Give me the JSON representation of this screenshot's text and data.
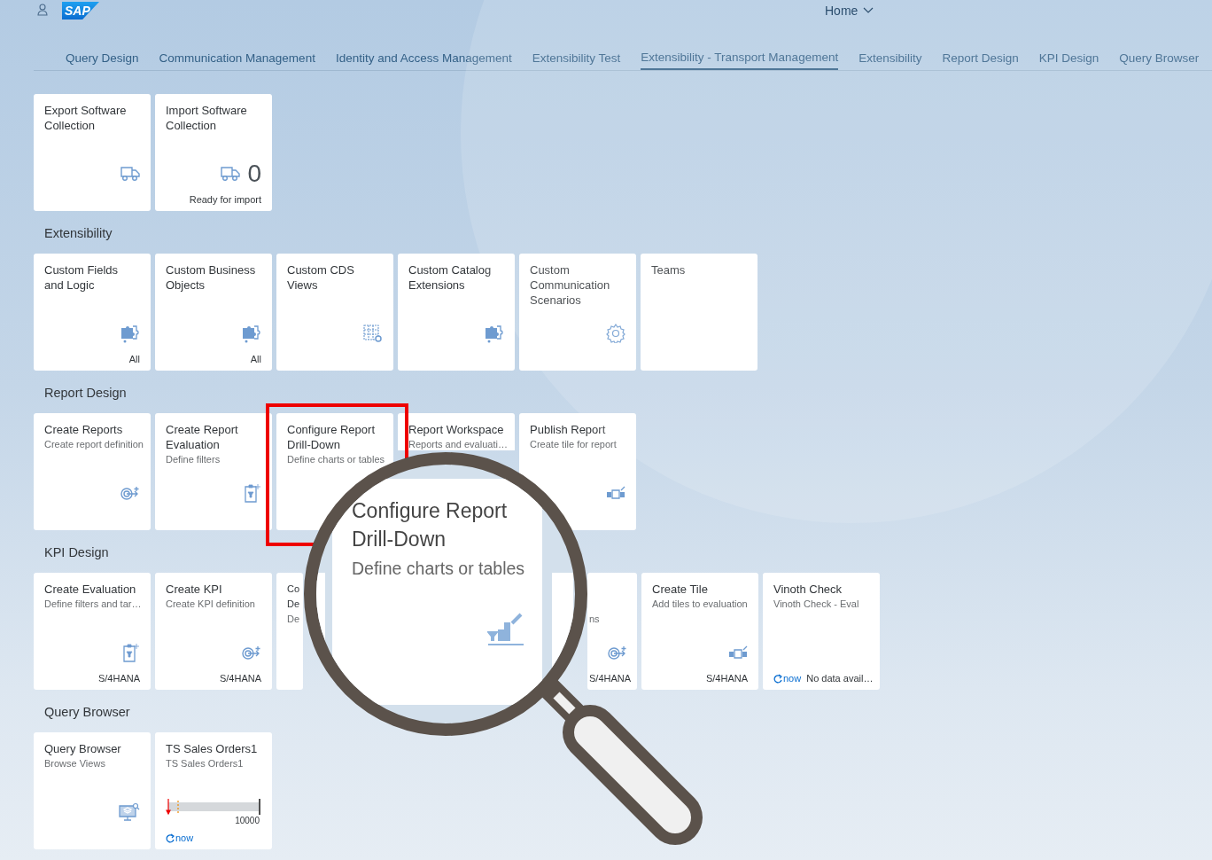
{
  "header": {
    "logo": "SAP",
    "title": "Home"
  },
  "tabs": [
    {
      "label": "Query Design",
      "selected": false
    },
    {
      "label": "Communication Management",
      "selected": false
    },
    {
      "label": "Identity and Access Management",
      "selected": false
    },
    {
      "label": "Extensibility Test",
      "selected": false
    },
    {
      "label": "Extensibility - Transport Management",
      "selected": true
    },
    {
      "label": "Extensibility",
      "selected": false
    },
    {
      "label": "Report Design",
      "selected": false
    },
    {
      "label": "KPI Design",
      "selected": false
    },
    {
      "label": "Query Browser",
      "selected": false
    }
  ],
  "groups": [
    {
      "tiles": [
        {
          "title": "Export Software Collection"
        },
        {
          "title": "Import Software Collection",
          "number": "0",
          "footer": "Ready for import"
        }
      ]
    },
    {
      "title": "Extensibility",
      "tiles": [
        {
          "title": "Custom Fields and Logic",
          "footer": "All"
        },
        {
          "title": "Custom Business Objects",
          "footer": "All"
        },
        {
          "title": "Custom CDS Views"
        },
        {
          "title": "Custom Catalog Extensions"
        },
        {
          "title": "Custom Communication Scenarios"
        },
        {
          "title": "Teams"
        }
      ]
    },
    {
      "title": "Report Design",
      "tiles": [
        {
          "title": "Create Reports",
          "subtitle": "Create report definition"
        },
        {
          "title": "Create Report Evaluation",
          "subtitle": "Define filters"
        },
        {
          "title": "Configure Report Drill-Down",
          "subtitle": "Define charts or tables"
        },
        {
          "kind": "clipped-bottom",
          "title": "Report Workspace",
          "subtitle": "Reports and evaluati…"
        },
        {
          "title": "Publish Report",
          "subtitle": "Create tile for report"
        }
      ]
    },
    {
      "title": "KPI Design",
      "tiles": [
        {
          "title": "Create Evaluation",
          "subtitle": "Define filters and tar…",
          "footer": "S/4HANA"
        },
        {
          "title": "Create KPI",
          "subtitle": "Create KPI definition",
          "footer": "S/4HANA"
        },
        {
          "kind": "clipped-left",
          "title": "Co De",
          "subtitle": "De"
        },
        {
          "kind": "hidden"
        },
        {
          "kind": "clipped-right",
          "subtitle": "ns",
          "footer": "S/4HANA"
        },
        {
          "title": "Create Tile",
          "subtitle": "Add tiles to evaluation",
          "footer": "S/4HANA"
        },
        {
          "title": "Vinoth Check",
          "subtitle": "Vinoth Check - Eval",
          "refresh": "now",
          "info": "No data avail…"
        }
      ]
    },
    {
      "title": "Query Browser",
      "tiles": [
        {
          "title": "Query Browser",
          "subtitle": "Browse Views"
        },
        {
          "title": "TS Sales Orders1",
          "subtitle": "TS Sales Orders1",
          "chart_label": "10000",
          "refresh": "now"
        }
      ]
    }
  ],
  "magnifier": {
    "title": "Configure Report Drill-Down",
    "subtitle": "Define charts or tables"
  }
}
